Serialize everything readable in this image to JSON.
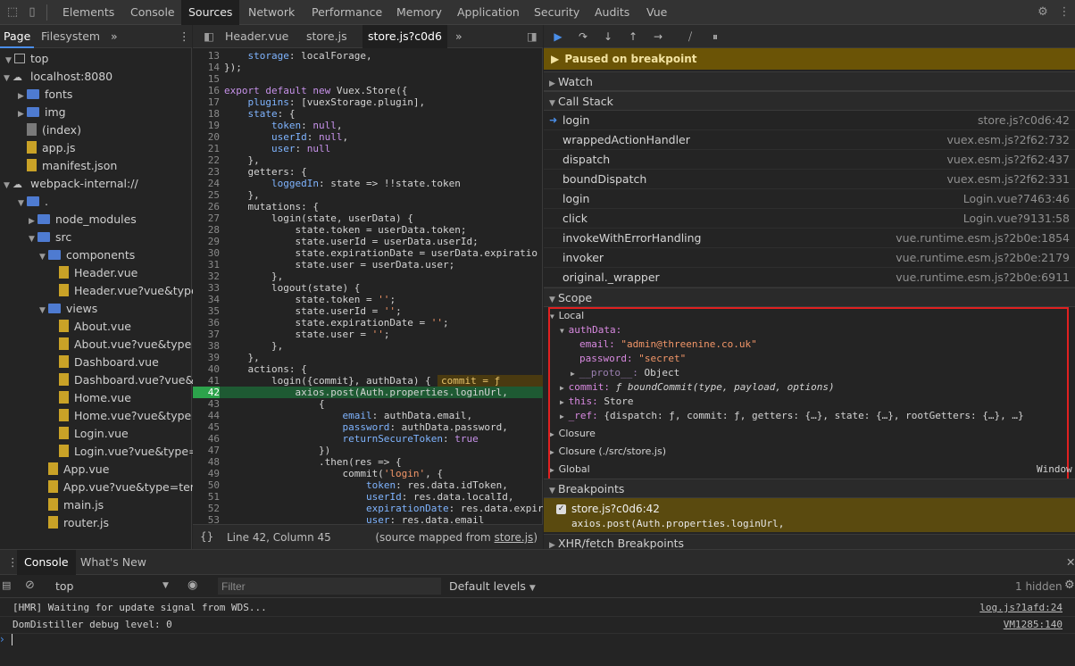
{
  "top_tabs": [
    "Elements",
    "Console",
    "Sources",
    "Network",
    "Performance",
    "Memory",
    "Application",
    "Security",
    "Audits",
    "Vue"
  ],
  "navigator": {
    "tabs": [
      "Page",
      "Filesystem"
    ],
    "tree": [
      {
        "label": "top",
        "kind": "frame",
        "level": 0,
        "open": true
      },
      {
        "label": "localhost:8080",
        "kind": "cloud",
        "level": 1,
        "open": true
      },
      {
        "label": "fonts",
        "kind": "folder",
        "level": 2,
        "open": false
      },
      {
        "label": "img",
        "kind": "folder",
        "level": 2,
        "open": false
      },
      {
        "label": "(index)",
        "kind": "file-gray",
        "level": 2
      },
      {
        "label": "app.js",
        "kind": "file",
        "level": 2
      },
      {
        "label": "manifest.json",
        "kind": "file",
        "level": 2
      },
      {
        "label": "webpack-internal://",
        "kind": "cloud",
        "level": 1,
        "open": true
      },
      {
        "label": ".",
        "kind": "folder",
        "level": 2,
        "open": true
      },
      {
        "label": "node_modules",
        "kind": "folder",
        "level": 3,
        "open": false
      },
      {
        "label": "src",
        "kind": "folder",
        "level": 3,
        "open": true
      },
      {
        "label": "components",
        "kind": "folder",
        "level": 4,
        "open": true
      },
      {
        "label": "Header.vue",
        "kind": "file",
        "level": 5
      },
      {
        "label": "Header.vue?vue&type",
        "kind": "file",
        "level": 5
      },
      {
        "label": "views",
        "kind": "folder",
        "level": 4,
        "open": true
      },
      {
        "label": "About.vue",
        "kind": "file",
        "level": 5
      },
      {
        "label": "About.vue?vue&type",
        "kind": "file",
        "level": 5
      },
      {
        "label": "Dashboard.vue",
        "kind": "file",
        "level": 5
      },
      {
        "label": "Dashboard.vue?vue&",
        "kind": "file",
        "level": 5
      },
      {
        "label": "Home.vue",
        "kind": "file",
        "level": 5
      },
      {
        "label": "Home.vue?vue&type",
        "kind": "file",
        "level": 5
      },
      {
        "label": "Login.vue",
        "kind": "file",
        "level": 5
      },
      {
        "label": "Login.vue?vue&type=",
        "kind": "file",
        "level": 5
      },
      {
        "label": "App.vue",
        "kind": "file",
        "level": 4
      },
      {
        "label": "App.vue?vue&type=ten",
        "kind": "file",
        "level": 4
      },
      {
        "label": "main.js",
        "kind": "file",
        "level": 4
      },
      {
        "label": "router.js",
        "kind": "file",
        "level": 4
      }
    ]
  },
  "editor": {
    "tabs": [
      "Header.vue",
      "store.js",
      "store.js?c0d6"
    ],
    "lines": [
      {
        "n": "13",
        "t": "    storage: localForage,"
      },
      {
        "n": "14",
        "t": "});"
      },
      {
        "n": "15",
        "t": ""
      },
      {
        "n": "16",
        "t": "export default new Vuex.Store({"
      },
      {
        "n": "17",
        "t": "    plugins: [vuexStorage.plugin],"
      },
      {
        "n": "18",
        "t": "    state: {"
      },
      {
        "n": "19",
        "t": "        token: null,"
      },
      {
        "n": "20",
        "t": "        userId: null,"
      },
      {
        "n": "21",
        "t": "        user: null"
      },
      {
        "n": "22",
        "t": "    },"
      },
      {
        "n": "23",
        "t": "    getters: {"
      },
      {
        "n": "24",
        "t": "        loggedIn: state => !!state.token"
      },
      {
        "n": "25",
        "t": "    },"
      },
      {
        "n": "26",
        "t": "    mutations: {"
      },
      {
        "n": "27",
        "t": "        login(state, userData) {"
      },
      {
        "n": "28",
        "t": "            state.token = userData.token;"
      },
      {
        "n": "29",
        "t": "            state.userId = userData.userId;"
      },
      {
        "n": "30",
        "t": "            state.expirationDate = userData.expiratio"
      },
      {
        "n": "31",
        "t": "            state.user = userData.user;"
      },
      {
        "n": "32",
        "t": "        },"
      },
      {
        "n": "33",
        "t": "        logout(state) {"
      },
      {
        "n": "34",
        "t": "            state.token = '';"
      },
      {
        "n": "35",
        "t": "            state.userId = '';"
      },
      {
        "n": "36",
        "t": "            state.expirationDate = '';"
      },
      {
        "n": "37",
        "t": "            state.user = '';"
      },
      {
        "n": "38",
        "t": "        },"
      },
      {
        "n": "39",
        "t": "    },"
      },
      {
        "n": "40",
        "t": "    actions: {"
      },
      {
        "n": "41",
        "t": "        login({commit}, authData) {"
      },
      {
        "n": "42",
        "t": "            axios.post(Auth.properties.loginUrl,"
      },
      {
        "n": "43",
        "t": "                {"
      },
      {
        "n": "44",
        "t": "                    email: authData.email,"
      },
      {
        "n": "45",
        "t": "                    password: authData.password,"
      },
      {
        "n": "46",
        "t": "                    returnSecureToken: true"
      },
      {
        "n": "47",
        "t": "                })"
      },
      {
        "n": "48",
        "t": "                .then(res => {"
      },
      {
        "n": "49",
        "t": "                    commit('login', {"
      },
      {
        "n": "50",
        "t": "                        token: res.data.idToken,"
      },
      {
        "n": "51",
        "t": "                        userId: res.data.localId,"
      },
      {
        "n": "52",
        "t": "                        expirationDate: res.data.expir"
      },
      {
        "n": "53",
        "t": "                        user: res.data.email"
      }
    ],
    "exec_line": "42",
    "inline_value": "commit = ƒ boundC",
    "status": {
      "position": "Line 42, Column 45",
      "mapped_prefix": "(source mapped from ",
      "mapped_link": "store.js",
      "mapped_suffix": ")"
    }
  },
  "debugger": {
    "paused_label": "Paused on breakpoint",
    "watch_label": "Watch",
    "callstack_label": "Call Stack",
    "callstack": [
      {
        "fn": "login",
        "loc": "store.js?c0d6:42",
        "current": true
      },
      {
        "fn": "wrappedActionHandler",
        "loc": "vuex.esm.js?2f62:732"
      },
      {
        "fn": "dispatch",
        "loc": "vuex.esm.js?2f62:437"
      },
      {
        "fn": "boundDispatch",
        "loc": "vuex.esm.js?2f62:331"
      },
      {
        "fn": "login",
        "loc": "Login.vue?7463:46"
      },
      {
        "fn": "click",
        "loc": "Login.vue?9131:58"
      },
      {
        "fn": "invokeWithErrorHandling",
        "loc": "vue.runtime.esm.js?2b0e:1854"
      },
      {
        "fn": "invoker",
        "loc": "vue.runtime.esm.js?2b0e:2179"
      },
      {
        "fn": "original._wrapper",
        "loc": "vue.runtime.esm.js?2b0e:6911"
      }
    ],
    "scope_label": "Scope",
    "scope": {
      "local": "Local",
      "authData": "authData:",
      "email_key": "email:",
      "email_val": "\"admin@threenine.co.uk\"",
      "password_key": "password:",
      "password_val": "\"secret\"",
      "proto_key": "__proto__:",
      "proto_val": "Object",
      "commit_key": "commit:",
      "commit_val": "ƒ boundCommit(type, payload, options)",
      "this_key": "this:",
      "this_val": "Store",
      "ref_key": "_ref:",
      "ref_val": "{dispatch: ƒ, commit: ƒ, getters: {…}, state: {…}, rootGetters: {…}, …}",
      "closure1": "Closure",
      "closure2": "Closure (./src/store.js)",
      "global": "Global",
      "global_val": "Window"
    },
    "breakpoints_label": "Breakpoints",
    "breakpoint": {
      "file": "store.js?c0d6:42",
      "code": "axios.post(Auth.properties.loginUrl,"
    },
    "xhr_label": "XHR/fetch Breakpoints"
  },
  "drawer": {
    "tabs": [
      "Console",
      "What's New"
    ],
    "context": "top",
    "filter_placeholder": "Filter",
    "levels": "Default levels",
    "hidden": "1 hidden",
    "messages": [
      {
        "text": "[HMR] Waiting for update signal from WDS...",
        "src": "log.js?1afd:24"
      },
      {
        "text": "DomDistiller debug level: 0",
        "src": "VM1285:140"
      }
    ]
  }
}
